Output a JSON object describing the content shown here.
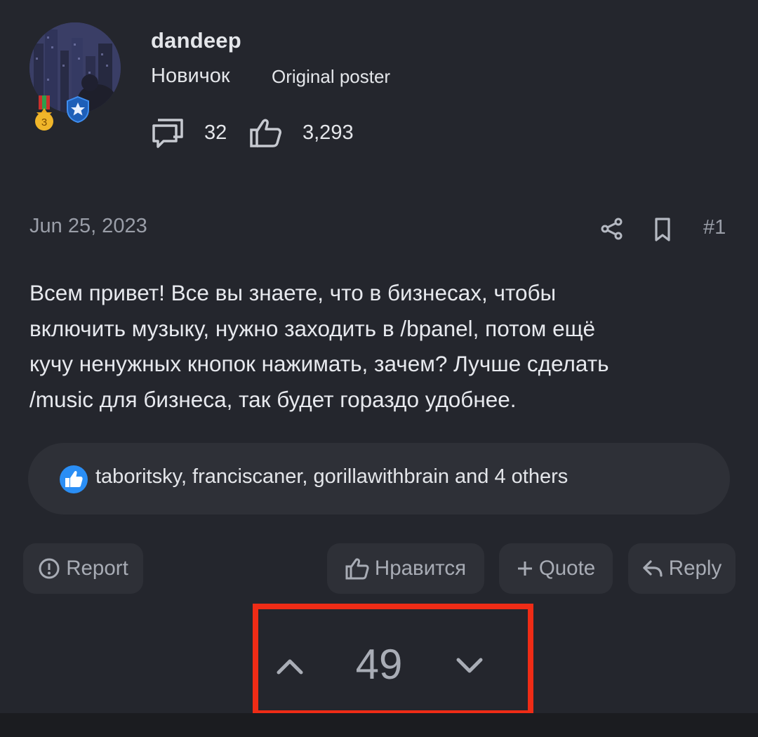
{
  "author": {
    "name": "dandeep",
    "title": "Новичок",
    "op_badge": "Original poster",
    "messages_count": "32",
    "likes_count": "3,293",
    "medal_level": "3"
  },
  "post": {
    "date": "Jun 25, 2023",
    "number": "#1",
    "body": "Всем привет! Все вы знаете, что в бизнесах, чтобы\nвключить музыку, нужно заходить в /bpanel, потом ещё\nкучу ненужных кнопок нажимать, зачем? Лучше сделать\n/music для бизнеса, так будет гораздо удобнее."
  },
  "reactions": {
    "text": "taboritsky, franciscaner, gorillawithbrain and 4 others"
  },
  "actions": {
    "report": "Report",
    "like": "Нравится",
    "quote": "Quote",
    "reply": "Reply"
  },
  "vote": {
    "count": "49"
  },
  "colors": {
    "background": "#24262d",
    "panel": "#2e3037",
    "highlight_border": "#ef2c16",
    "reaction_blue": "#2a8ef5"
  },
  "icons": {
    "messages": "messages-icon",
    "likes": "thumbs-up-icon",
    "share": "share-icon",
    "bookmark": "bookmark-icon",
    "report": "exclamation-circle-icon",
    "quote": "plus-icon",
    "reply": "reply-arrow-icon",
    "vote_up": "chevron-up-icon",
    "vote_down": "chevron-down-icon"
  }
}
